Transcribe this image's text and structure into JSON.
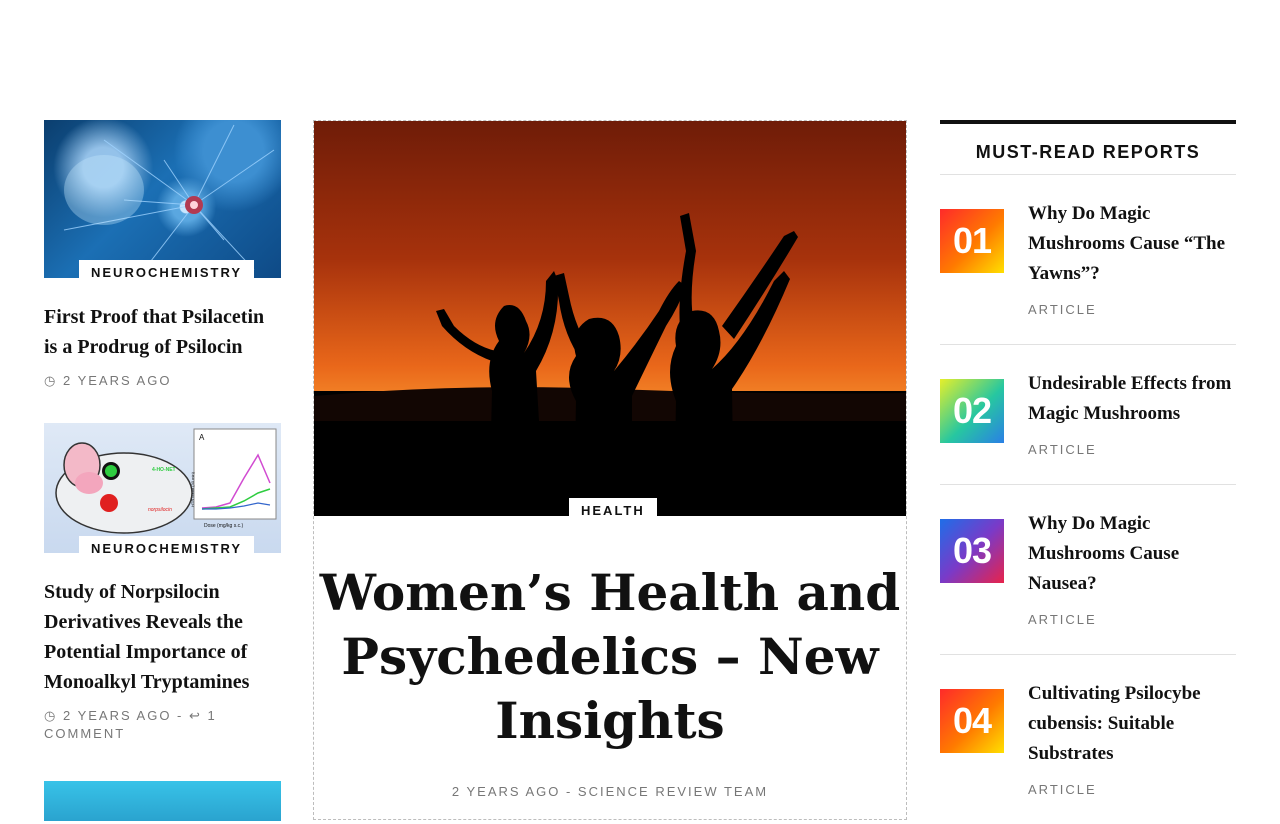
{
  "left_column": {
    "cards": [
      {
        "category": "NEUROCHEMISTRY",
        "title": "First Proof that Psilacetin is a Prodrug of Psilocin",
        "time": "2 YEARS AGO"
      },
      {
        "category": "NEUROCHEMISTRY",
        "title": "Study of Norpsilocin Derivatives Reveals the Potential Importance of Monoalkyl Tryptamines",
        "time": "2 YEARS AGO",
        "separator": " - ",
        "comments": "1 COMMENT"
      }
    ],
    "figure_labels": {
      "norpsilocin": "norpsilocin",
      "ho_net": "4-HO-NET",
      "panel": "A",
      "xlabel": "Dose (mg/kg s.c.)",
      "ylabel": "HTR count (30 min)"
    }
  },
  "featured": {
    "category": "HEALTH",
    "title": "Women’s Health and Psychedelics – New Insights",
    "time": "2 YEARS AGO",
    "separator": " - ",
    "author": "SCIENCE REVIEW TEAM"
  },
  "sidebar": {
    "heading": "MUST-READ REPORTS",
    "reports": [
      {
        "number": "01",
        "title": "Why Do Magic Mushrooms Cause “The Yawns”?",
        "tag": "ARTICLE"
      },
      {
        "number": "02",
        "title": "Undesirable Effects from Magic Mushrooms",
        "tag": "ARTICLE"
      },
      {
        "number": "03",
        "title": "Why Do Magic Mushrooms Cause Nausea?",
        "tag": "ARTICLE"
      },
      {
        "number": "04",
        "title": "Cultivating Psilocybe cubensis: Suitable Substrates",
        "tag": "ARTICLE"
      }
    ]
  },
  "icons": {
    "clock": "clock-icon",
    "reply": "reply-icon"
  },
  "colors": {
    "text": "#111111",
    "meta": "#777777",
    "rule": "#e1e1e1"
  }
}
